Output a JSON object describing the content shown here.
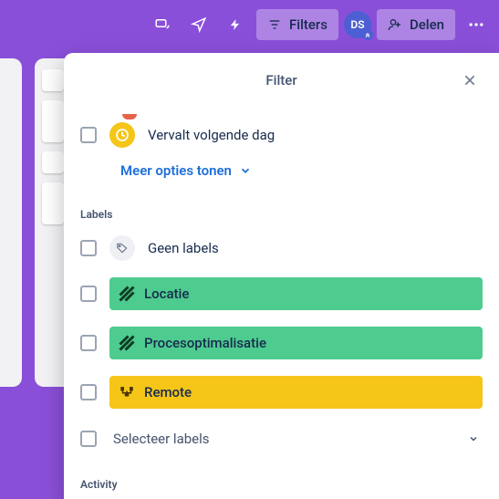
{
  "topbar": {
    "filters_label": "Filters",
    "share_label": "Delen",
    "avatar_initials": "DS"
  },
  "panel": {
    "title": "Filter"
  },
  "due": {
    "expires_next_day": "Vervalt volgende dag",
    "more_options": "Meer opties tonen"
  },
  "sections": {
    "labels_title": "Labels",
    "activity_title": "Activity"
  },
  "labels": {
    "no_labels": "Geen labels",
    "items": [
      {
        "name": "Locatie",
        "color": "green"
      },
      {
        "name": "Procesoptimalisatie",
        "color": "green"
      },
      {
        "name": "Remote",
        "color": "yellow"
      }
    ],
    "select_labels": "Selecteer labels"
  }
}
